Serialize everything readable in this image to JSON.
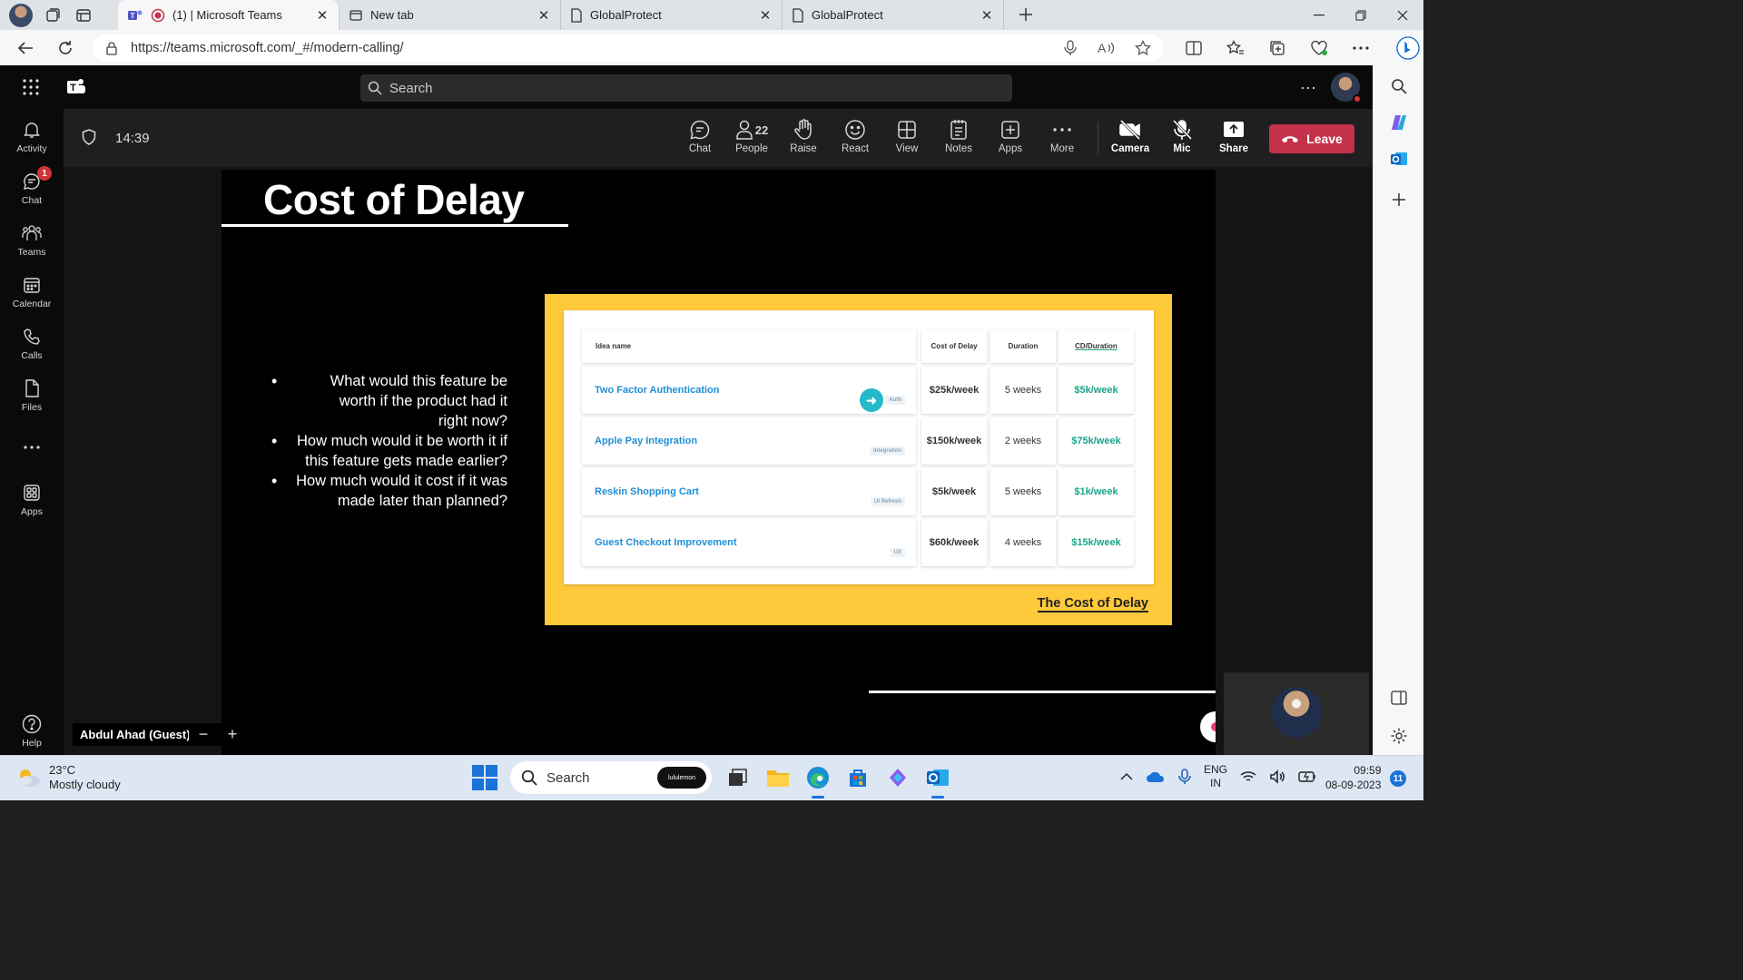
{
  "browser": {
    "tabs": [
      {
        "title": "(1) | Microsoft Teams",
        "active": true
      },
      {
        "title": "New tab",
        "active": false
      },
      {
        "title": "GlobalProtect",
        "active": false
      },
      {
        "title": "GlobalProtect",
        "active": false
      }
    ],
    "url": "https://teams.microsoft.com/_#/modern-calling/"
  },
  "teams": {
    "search_placeholder": "Search",
    "rail": [
      {
        "label": "Activity",
        "icon": "bell-icon"
      },
      {
        "label": "Chat",
        "icon": "chat-icon",
        "badge": "1"
      },
      {
        "label": "Teams",
        "icon": "teams-icon"
      },
      {
        "label": "Calendar",
        "icon": "calendar-icon"
      },
      {
        "label": "Calls",
        "icon": "phone-icon"
      },
      {
        "label": "Files",
        "icon": "file-icon"
      },
      {
        "label": "Apps",
        "icon": "apps-icon"
      },
      {
        "label": "Help",
        "icon": "help-icon"
      }
    ]
  },
  "meeting": {
    "timer": "14:39",
    "controls": {
      "chat": "Chat",
      "people": "People",
      "people_count": "22",
      "raise": "Raise",
      "react": "React",
      "view": "View",
      "notes": "Notes",
      "apps": "Apps",
      "more": "More",
      "camera": "Camera",
      "mic": "Mic",
      "share": "Share",
      "leave": "Leave"
    },
    "presenter_name": "Abdul Ahad (Guest)",
    "zoom_out": "−",
    "zoom_in": "+"
  },
  "slide": {
    "title": "Cost of Delay",
    "bullets": [
      "What would this feature be worth if the product had it right now?",
      "How much would it be worth it if this feature gets made earlier?",
      "How much would it cost if it was made later than planned?"
    ],
    "table": {
      "headers": [
        "Idea name",
        "Cost of Delay",
        "Duration",
        "CD/Duration"
      ],
      "rows": [
        {
          "idea": "Two Factor Authentication",
          "tag": "Auth",
          "cod": "$25k/week",
          "duration": "5 weeks",
          "cdd": "$5k/week"
        },
        {
          "idea": "Apple Pay Integration",
          "tag": "Integration",
          "cod": "$150k/week",
          "duration": "2 weeks",
          "cdd": "$75k/week"
        },
        {
          "idea": "Reskin Shopping Cart",
          "tag": "UI Refresh",
          "cod": "$5k/week",
          "duration": "5 weeks",
          "cdd": "$1k/week"
        },
        {
          "idea": "Guest Checkout Improvement",
          "tag": "UX",
          "cod": "$60k/week",
          "duration": "4 weeks",
          "cdd": "$15k/week"
        }
      ]
    },
    "caption": "The Cost of Delay"
  },
  "taskbar": {
    "temperature": "23°C",
    "weather": "Mostly cloudy",
    "search_placeholder": "Search",
    "lulu_label": "lululemon",
    "lang_top": "ENG",
    "lang_bottom": "IN",
    "time": "09:59",
    "date": "08-09-2023",
    "notifications": "11"
  }
}
